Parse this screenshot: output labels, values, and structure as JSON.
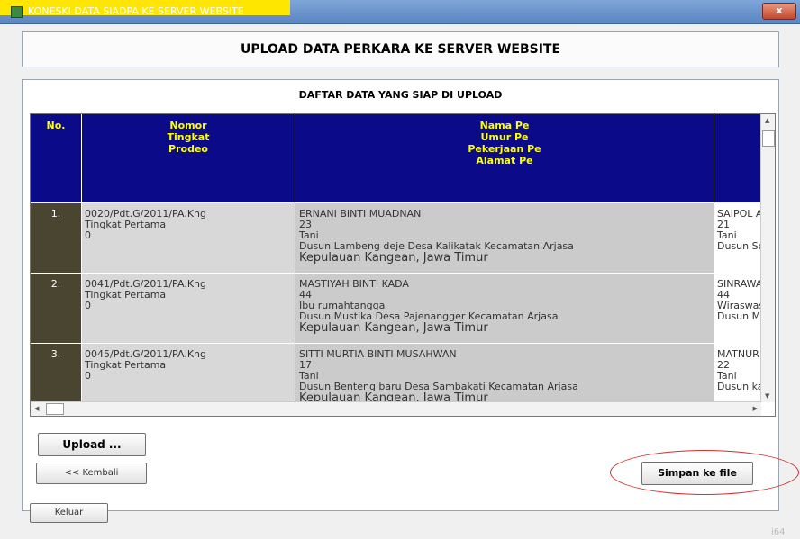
{
  "window": {
    "title": "KONESKI DATA SIADPA KE SERVER WEBSITE",
    "close_label": "x"
  },
  "header": {
    "title": "UPLOAD DATA PERKARA KE SERVER WEBSITE"
  },
  "list": {
    "title": "DAFTAR DATA YANG SIAP DI UPLOAD",
    "columns": [
      {
        "lines": [
          "No."
        ]
      },
      {
        "lines": [
          "Nomor",
          "Tingkat",
          "Prodeo"
        ]
      },
      {
        "lines": [
          "Nama Pe",
          "Umur Pe",
          "Pekerjaan Pe",
          "Alamat Pe"
        ]
      }
    ],
    "rows": [
      {
        "no": "1.",
        "nomor": "0020/Pdt.G/2011/PA.Kng",
        "tingkat": "Tingkat Pertama",
        "prodeo": "0",
        "nama": "ERNANI BINTI MUADNAN",
        "umur": "23",
        "pekerjaan": "Tani",
        "alamat1": "Dusun Lambeng deje Desa Kalikatak Kecamatan Arjasa",
        "alamat2": "Kepulauan Kangean, Jawa Timur",
        "t_nama": "SAIPOL A",
        "t_umur": "21",
        "t_pekerjaan": "Tani",
        "t_alamat": "Dusun So"
      },
      {
        "no": "2.",
        "nomor": "0041/Pdt.G/2011/PA.Kng",
        "tingkat": "Tingkat Pertama",
        "prodeo": "0",
        "nama": "MASTIYAH BINTI KADA",
        "umur": "44",
        "pekerjaan": "Ibu rumahtangga",
        "alamat1": "Dusun Mustika Desa Pajenangger Kecamatan Arjasa",
        "alamat2": "Kepulauan Kangean, Jawa Timur",
        "t_nama": "SINRAWA",
        "t_umur": "44",
        "t_pekerjaan": "Wiraswas",
        "t_alamat": "Dusun Mu"
      },
      {
        "no": "3.",
        "nomor": "0045/Pdt.G/2011/PA.Kng",
        "tingkat": "Tingkat Pertama",
        "prodeo": "0",
        "nama": "SITTI MURTIA BINTI MUSAHWAN",
        "umur": "17",
        "pekerjaan": "Tani",
        "alamat1": "Dusun Benteng baru Desa Sambakati Kecamatan Arjasa",
        "alamat2": "Kepulauan Kangean, Jawa Timur",
        "t_nama": "MATNUR",
        "t_umur": "22",
        "t_pekerjaan": "Tani",
        "t_alamat": "Dusun ka"
      }
    ]
  },
  "buttons": {
    "upload": "Upload ...",
    "kembali": "<< Kembali",
    "simpan": "Simpan ke file",
    "keluar": "Keluar"
  },
  "watermark": "i64"
}
